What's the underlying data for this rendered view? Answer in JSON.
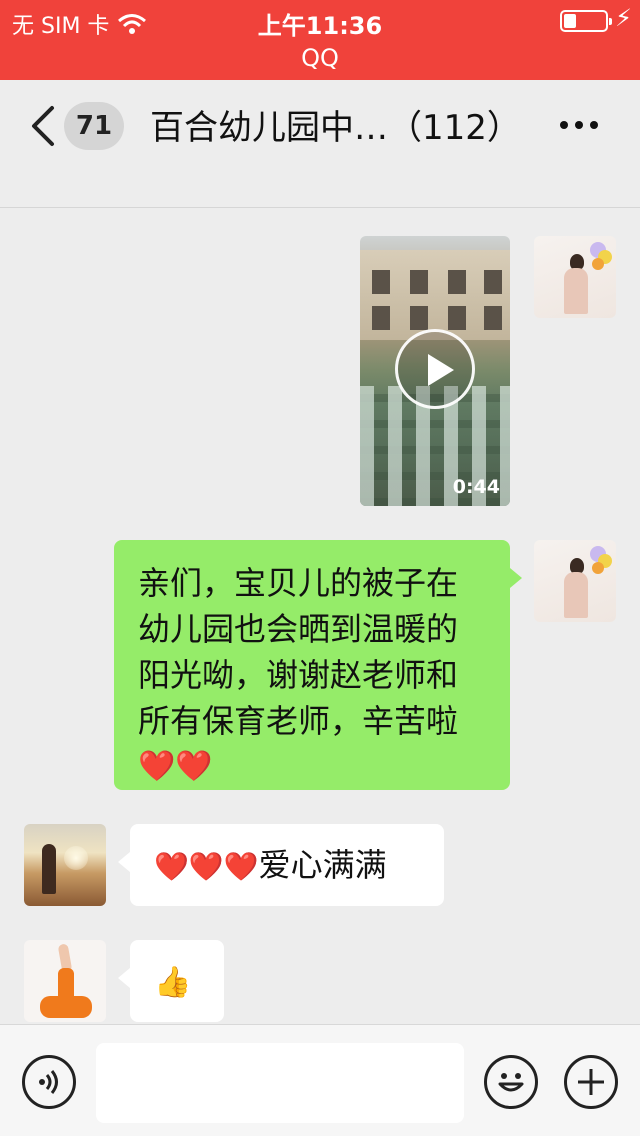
{
  "status_bar": {
    "carrier": "无 SIM 卡",
    "time": "上午11:36",
    "app_name": "QQ",
    "battery_level": 0.3
  },
  "nav": {
    "unread_count": "71",
    "title": "百合幼儿园中…（112）"
  },
  "messages": [
    {
      "sender": "self",
      "type": "video",
      "duration": "0:44"
    },
    {
      "sender": "self",
      "type": "text",
      "text": "亲们，宝贝儿的被子在\n幼儿园也会晒到温暖的\n阳光呦，谢谢赵老师和\n所有保育老师，辛苦啦",
      "emoji": "❤️❤️"
    },
    {
      "sender": "other",
      "type": "text",
      "emoji": "❤️❤️❤️",
      "text": "爱心满满"
    },
    {
      "sender": "other",
      "type": "text",
      "emoji": "👍"
    }
  ],
  "icons": {
    "back": "chevron-left-icon",
    "more": "more-dots-icon",
    "voice": "voice-icon",
    "emoji": "emoji-icon",
    "add": "plus-icon",
    "wifi": "wifi-icon",
    "battery": "battery-icon"
  },
  "colors": {
    "status_bar": "#f0423b",
    "self_bubble": "#95ec69",
    "other_bubble": "#ffffff",
    "background": "#ededed"
  }
}
